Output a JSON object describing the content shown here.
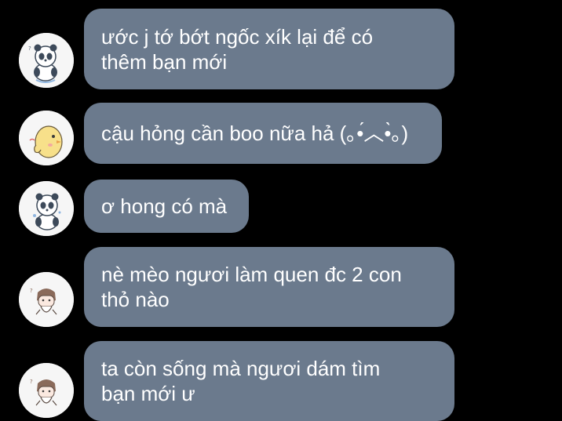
{
  "colors": {
    "background": "#000000",
    "bubble": "#6b7a8d",
    "text": "#ffffff"
  },
  "messages": [
    {
      "avatar": "panda-sticker-avatar",
      "text": "ước j tớ bớt ngốc xík lại để có\nthêm bạn mới"
    },
    {
      "avatar": "chick-sticker-avatar",
      "text": "cậu hỏng cần boo nữa hả (｡•́︿•̀｡)"
    },
    {
      "avatar": "panda-sticker-avatar",
      "text": "ơ hong có mà"
    },
    {
      "avatar": "cat-sticker-avatar",
      "text": "nè mèo ngươi làm quen đc 2 con\nthỏ nào"
    },
    {
      "avatar": "cat-sticker-avatar",
      "text": "ta còn sống mà ngươi dám tìm\nbạn mới ư"
    }
  ]
}
